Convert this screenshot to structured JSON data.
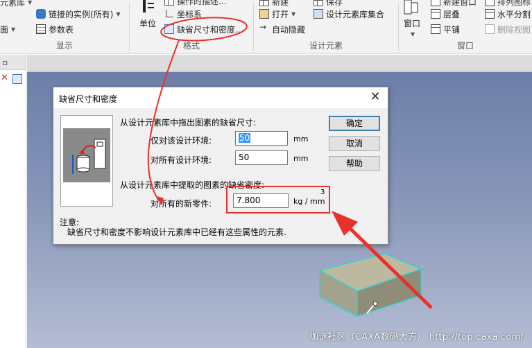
{
  "ribbon": {
    "display_group": {
      "items": [
        "元素库",
        "链接的实例(所有)",
        "面",
        "参数表"
      ],
      "title": "显示"
    },
    "format_group": {
      "unit_label": "单位",
      "items": [
        "操作的描述...",
        "坐标系",
        "缺省尺寸和密度..."
      ],
      "title": "格式"
    },
    "design_group": {
      "items": [
        "新建",
        "保存",
        "打开",
        "设计元素库集合",
        "自动隐藏"
      ],
      "title": "设计元素"
    },
    "window_group": {
      "window_label": "窗口",
      "items": [
        "新建窗口",
        "排列图标",
        "层叠",
        "水平分割",
        "平铺",
        "删除视图"
      ],
      "title": "窗口"
    }
  },
  "dialog": {
    "title": "缺省尺寸和密度",
    "close_glyph": "✕",
    "drag_section": "从设计元素库中拖出图素的缺省尺寸:",
    "env_only_label": "仅对该设计环境:",
    "env_only_value": "50",
    "all_env_label": "对所有设计环境:",
    "all_env_value": "50",
    "unit_mm": "mm",
    "density_section": "从设计元素库中提取的图素的缺省密度:",
    "new_parts_label": "对所有的新零件:",
    "density_value": "7.800",
    "density_unit": "kg / mm",
    "density_exp": "3",
    "ok_label": "确定",
    "cancel_label": "取消",
    "help_label": "帮助",
    "note_label": "注意:",
    "note_text": "缺省尺寸和密度不影响设计元素库中已经有这些属性的元素."
  },
  "left_panel": {
    "pin_glyph": "ㅁ"
  },
  "watermark": "咖谜社区（CAXA数码大方） http://top.caxa.com/",
  "colors": {
    "annotation_red": "#e8312a",
    "focus_blue": "#3c7fb1",
    "selection_blue": "#3399ff",
    "box_face": "#a4a28c",
    "box_edge": "#37d0d2"
  }
}
